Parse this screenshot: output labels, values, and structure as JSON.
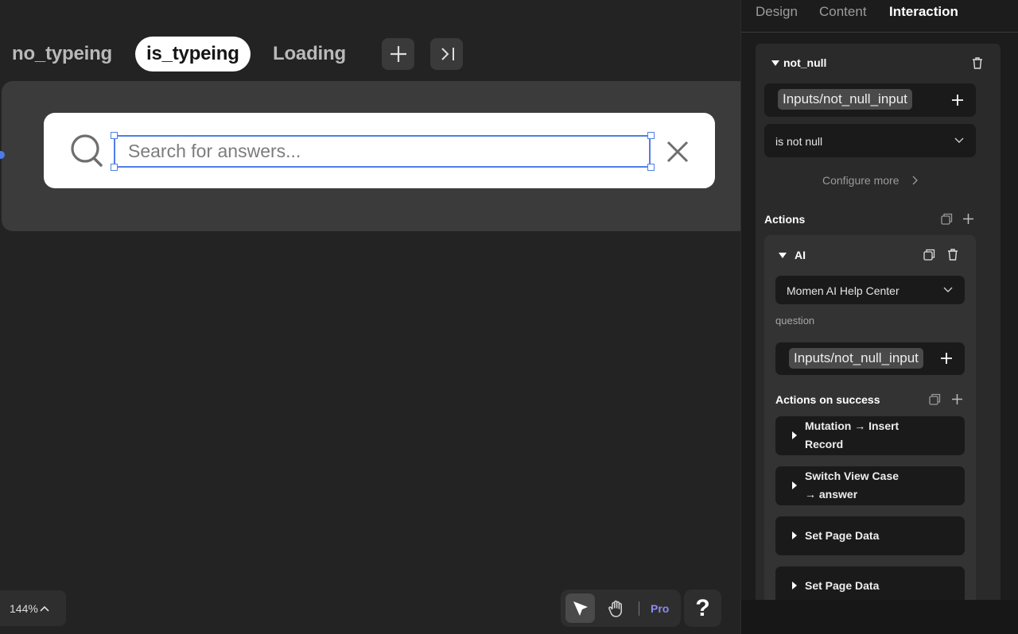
{
  "canvas": {
    "state_tabs": [
      {
        "label": "no_typeing"
      },
      {
        "label": "is_typeing"
      },
      {
        "label": "Loading"
      }
    ],
    "search": {
      "placeholder": "Search for answers..."
    },
    "zoom": "144%",
    "toolbar": {
      "pro_label": "Pro",
      "help_label": "?"
    }
  },
  "panel": {
    "tabs": [
      "Design",
      "Content",
      "Interaction"
    ],
    "active_tab": "Interaction",
    "condition": {
      "name": "not_null",
      "input_chip": "Inputs/not_null_input",
      "operator": "is not null",
      "configure_more": "Configure more"
    },
    "actions_label": "Actions",
    "ai_action": {
      "name": "AI",
      "model": "Momen AI Help Center",
      "param_label": "question",
      "param_chip": "Inputs/not_null_input"
    },
    "actions_on_success_label": "Actions on success",
    "success_actions": [
      {
        "line1": "Mutation → Insert",
        "line2": "Record"
      },
      {
        "line1": "Switch View Case",
        "line2": "→ answer"
      },
      {
        "line1": "Set Page Data",
        "line2": ""
      },
      {
        "line1": "Set Page Data",
        "line2": ""
      }
    ]
  },
  "colors": {
    "accent": "#4f7fe6",
    "pro": "#8b8bf0"
  }
}
